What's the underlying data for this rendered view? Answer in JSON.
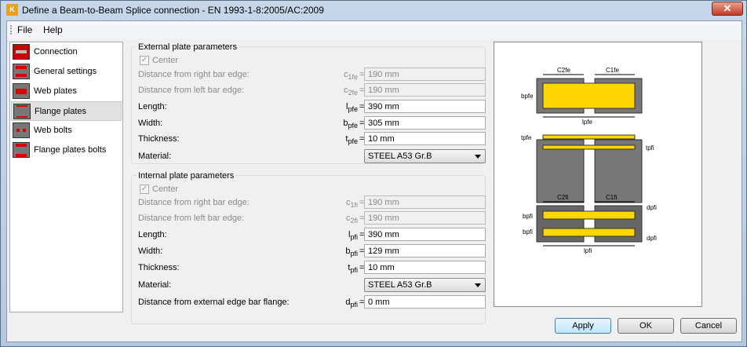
{
  "window": {
    "title": "Define a Beam-to-Beam Splice connection - EN 1993-1-8:2005/AC:2009",
    "icon_letter": "K",
    "close": "✕"
  },
  "menu": {
    "file": "File",
    "help": "Help"
  },
  "nav": [
    {
      "label": "Connection"
    },
    {
      "label": "General settings"
    },
    {
      "label": "Web plates"
    },
    {
      "label": "Flange plates",
      "selected": true
    },
    {
      "label": "Web bolts"
    },
    {
      "label": "Flange plates bolts"
    }
  ],
  "external": {
    "title": "External plate parameters",
    "center": "Center",
    "c1": {
      "label": "Distance from right bar edge:",
      "sym": "c",
      "sub": "1fe",
      "value": "190 mm"
    },
    "c2": {
      "label": "Distance from left bar edge:",
      "sym": "c",
      "sub": "2fe",
      "value": "190 mm"
    },
    "length": {
      "label": "Length:",
      "sym": "l",
      "sub": "pfe",
      "value": "390 mm"
    },
    "width": {
      "label": "Width:",
      "sym": "b",
      "sub": "pfe",
      "value": "305 mm"
    },
    "thickness": {
      "label": "Thickness:",
      "sym": "t",
      "sub": "pfe",
      "value": "10 mm"
    },
    "material": {
      "label": "Material:",
      "value": "STEEL A53 Gr.B"
    }
  },
  "internal": {
    "title": "Internal plate parameters",
    "center": "Center",
    "c1": {
      "label": "Distance from right bar edge:",
      "sym": "c",
      "sub": "1fi",
      "value": "190 mm"
    },
    "c2": {
      "label": "Distance from left bar edge:",
      "sym": "c",
      "sub": "2fi",
      "value": "190 mm"
    },
    "length": {
      "label": "Length:",
      "sym": "l",
      "sub": "pfi",
      "value": "390 mm"
    },
    "width": {
      "label": "Width:",
      "sym": "b",
      "sub": "pfi",
      "value": "129 mm"
    },
    "thickness": {
      "label": "Thickness:",
      "sym": "t",
      "sub": "pfi",
      "value": "10 mm"
    },
    "material": {
      "label": "Material:",
      "value": "STEEL A53 Gr.B"
    },
    "distance": {
      "label": "Distance from external edge bar flange:",
      "sym": "d",
      "sub": "pfi",
      "value": "0 mm"
    }
  },
  "diagram": {
    "c2fe": "C2fe",
    "c1fe": "C1fe",
    "bpfe": "bpfe",
    "lpfe": "lpfe",
    "tpfe": "tpfe",
    "tpfi": "tpfi",
    "c2fi": "C2fi",
    "c1fi": "C1fi",
    "bpfi": "bpfi",
    "dpfi": "dpfi",
    "lpfi": "lpfi"
  },
  "buttons": {
    "apply": "Apply",
    "ok": "OK",
    "cancel": "Cancel"
  }
}
